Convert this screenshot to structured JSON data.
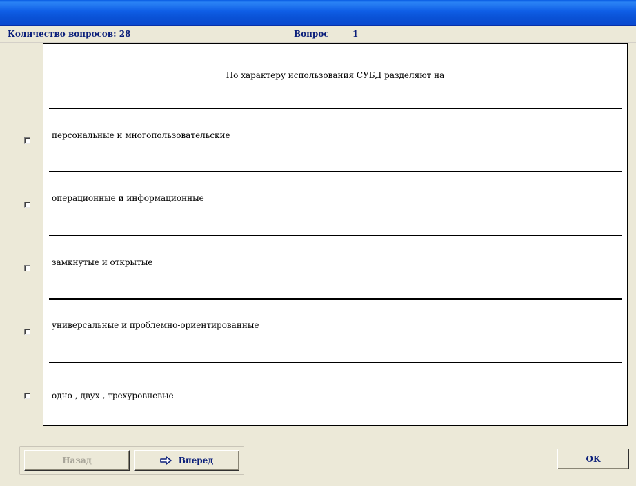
{
  "header": {
    "count_label": "Количество вопросов: 28",
    "question_label": "Вопрос",
    "question_number": "1"
  },
  "question": {
    "text": "По характеру  использования СУБД разделяют на"
  },
  "answers": [
    {
      "text": "персональные и многопользовательские",
      "checked": false
    },
    {
      "text": "операционные и информационные",
      "checked": false
    },
    {
      "text": " замкнутые  и открытые",
      "checked": false
    },
    {
      "text": "универсальные и проблемно-ориентированные",
      "checked": false
    },
    {
      "text": "одно-, двух-, трехуровневые",
      "checked": false
    }
  ],
  "buttons": {
    "back_label": "Назад",
    "forward_label": "Вперед",
    "ok_label": "OK"
  },
  "icons": {
    "forward": "arrow-right-outline-icon"
  },
  "colors": {
    "title_bar": "#0a52d6",
    "label_text": "#0b1f7a",
    "disabled_text": "#a9a69a",
    "window_bg": "#ece9d8"
  }
}
